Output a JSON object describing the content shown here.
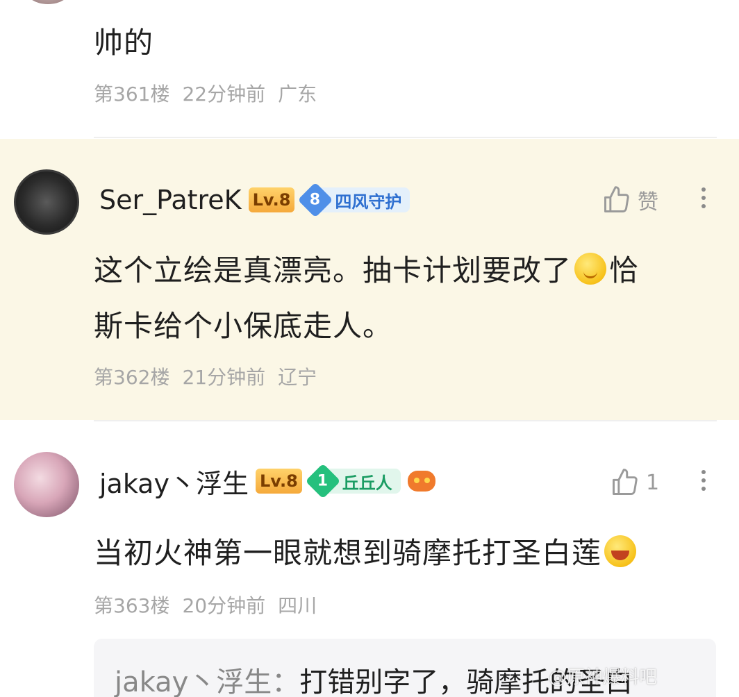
{
  "comments": [
    {
      "content": "帅的",
      "floor": "第361楼",
      "time": "22分钟前",
      "location": "广东"
    },
    {
      "username": "Ser_PatreK",
      "level": "Lv.8",
      "fan_level": "8",
      "fan_title": "四风守护",
      "like_label": "赞",
      "content_line1": "这个立绘是真漂亮。抽卡计划要改了",
      "content_line1_tail": "恰",
      "content_line2": "斯卡给个小保底走人。",
      "floor": "第362楼",
      "time": "21分钟前",
      "location": "辽宁"
    },
    {
      "username": "jakay丶浮生",
      "level": "Lv.8",
      "fan_level": "1",
      "fan_title": "丘丘人",
      "like_count": "1",
      "content": "当初火神第一眼就想到骑摩托打圣白莲",
      "floor": "第363楼",
      "time": "20分钟前",
      "location": "四川",
      "reply": {
        "author": "jakay丶浮生：",
        "text": "打错别字了，骑摩托的圣白"
      }
    }
  ],
  "watermark": "@原神爆料吧",
  "icons": {
    "like": "thumbs-up-icon",
    "more": "more-vertical-icon",
    "emoji_shy": "smile-emoji-icon",
    "emoji_laugh": "laugh-emoji-icon",
    "game": "gamepad-icon"
  },
  "colors": {
    "highlight_bg": "#fbf7e6",
    "meta_text": "#a6a6a6",
    "level_badge": "#f5a93b",
    "fan_blue": "#4f8fe8",
    "fan_green": "#25c07d"
  }
}
